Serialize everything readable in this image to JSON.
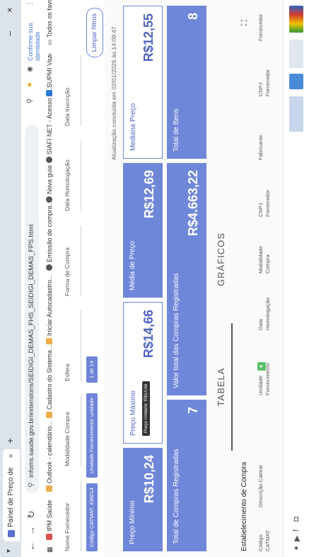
{
  "browser": {
    "tab_title": "Painel de Preço de Saúde",
    "url": "infoms.saude.gov.br/extensions/SEIDIGI_DEMAS_FHS_SEIDIGI_DEMAS_FPS.html",
    "confirm_text": "Confirme sua identidade",
    "all_favorites": "Todos os favoritos"
  },
  "bookmarks": [
    {
      "label": "IPM Saúde",
      "color": "#d9534f"
    },
    {
      "label": "Outlook - calendário...",
      "color": "#f0ad4e"
    },
    {
      "label": "Cadastro do Sistema...",
      "color": "#f0ad4e"
    },
    {
      "label": "Iniciar Autocadastro...",
      "color": "#f0ad4e"
    },
    {
      "label": "Emissão de compra...",
      "color": "#555555"
    },
    {
      "label": "Nova guia",
      "color": "#555555"
    },
    {
      "label": "SIAFI NET - Acesso d...",
      "color": "#555555"
    },
    {
      "label": "SUPMI Vaz",
      "color": "#2a7bd3"
    }
  ],
  "filters": {
    "labels": [
      "Nome Fornecedor",
      "Modalidade Compra",
      "Esfera",
      "Forma de Compra",
      "Data Homologação",
      "Data Inscrição"
    ],
    "chips": [
      "Código CATMAT: 436014",
      "Unidade Fornecimento: unidade",
      "1 de 14"
    ],
    "clear_button": "Limpar filtros"
  },
  "updated_text": "Atualização concluída em 02/01/2026 às 14:09:47",
  "cards": {
    "preco_minimo": {
      "title": "Preço Mínimo",
      "value": "R$10,24"
    },
    "preco_maximo": {
      "title": "Preço Máximo",
      "value": "R$14,66",
      "tooltip": "Preço Unitário: R$14,66"
    },
    "media_preco": {
      "title": "Média de Preço",
      "value": "R$12,69"
    },
    "mediana_preco": {
      "title": "Mediana Preço",
      "value": "R$12,55"
    },
    "total_compras": {
      "title": "Total de Compras Registradas",
      "value": "7"
    },
    "valor_total": {
      "title": "Valor total das Compras Registradas",
      "value": "R$4.663,22"
    },
    "total_bens": {
      "title": "Total de Bens",
      "value": "8"
    }
  },
  "views": {
    "table": "TABELA",
    "charts": "GRÁFICOS"
  },
  "table": {
    "title": "Estabelecimento de Compra",
    "columns": [
      "Código CATMAT",
      "Descrição Catmat",
      "Unidade Fornecimento",
      "Data Homologação",
      "Modalidade Compra",
      "CNPJ Fornecedor",
      "Fabricante",
      "CNPJ Fornecedor",
      "Fornecedor"
    ]
  }
}
